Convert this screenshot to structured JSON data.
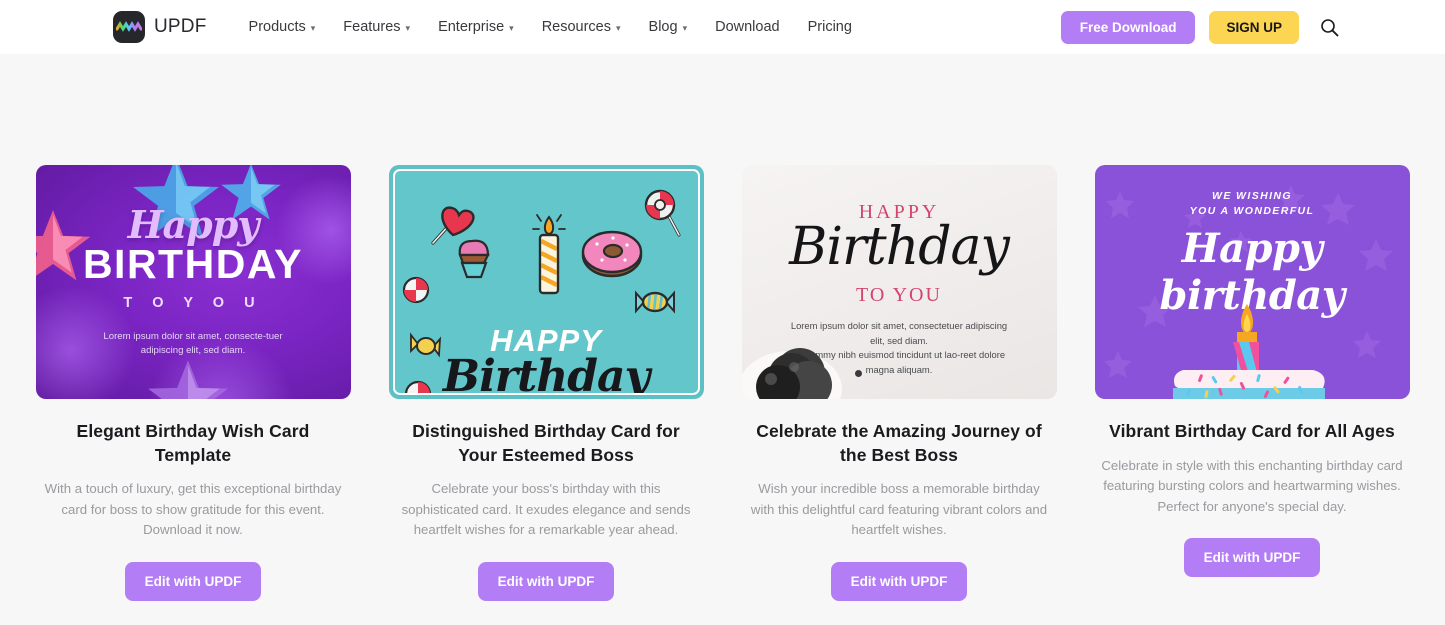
{
  "header": {
    "brand_name": "UPDF",
    "logo_icon": "updf-wave-logo-icon",
    "nav": [
      {
        "label": "Products",
        "has_dropdown": true
      },
      {
        "label": "Features",
        "has_dropdown": true
      },
      {
        "label": "Enterprise",
        "has_dropdown": true
      },
      {
        "label": "Resources",
        "has_dropdown": true
      },
      {
        "label": "Blog",
        "has_dropdown": true
      },
      {
        "label": "Download",
        "has_dropdown": false
      },
      {
        "label": "Pricing",
        "has_dropdown": false
      }
    ],
    "free_download_label": "Free Download",
    "sign_up_label": "SIGN UP",
    "search_icon": "search-icon",
    "colors": {
      "free_download_bg": "#b37ef5",
      "sign_up_bg": "#fcd552",
      "nav_text": "#3a3a3e",
      "header_bg": "#ffffff"
    }
  },
  "page": {
    "background": "#f7f7f7",
    "accent": "#b37ef5"
  },
  "cards": [
    {
      "title": "Elegant Birthday Wish Card Template",
      "description": "With a touch of luxury, get this exceptional birthday card for boss to show gratitude for this event. Download it now.",
      "button_label": "Edit with UPDF",
      "preview": {
        "style": "purple-balloons",
        "line_script": "Happy",
        "line_bold": "BIRTHDAY",
        "line_small": "T O  Y O U",
        "lorem": "Lorem ipsum dolor sit amet, consecte-tuer adipiscing elit, sed diam.",
        "bg_color": "#7b25c4"
      }
    },
    {
      "title": "Distinguished Birthday Card for Your Esteemed Boss",
      "description": "Celebrate your boss's birthday with this sophisticated card. It exudes elegance and sends heartfelt wishes for a remarkable year ahead.",
      "button_label": "Edit with UPDF",
      "preview": {
        "style": "teal-candy",
        "line_bold": "HAPPY",
        "line_script": "Birthday",
        "bg_color": "#63c6ca"
      }
    },
    {
      "title": "Celebrate the Amazing Journey of the Best Boss",
      "description": "Wish your incredible boss a memorable birthday with this delightful card featuring vibrant colors and heartfelt wishes.",
      "button_label": "Edit with UPDF",
      "preview": {
        "style": "cream-elegant",
        "line_top": "HAPPY",
        "line_script": "Birthday",
        "line_small": "TO YOU",
        "lorem_1": "Lorem ipsum dolor sit amet, consectetuer adipiscing elit, sed diam.",
        "lorem_2": "Nonummy nibh euismod tincidunt ut lao-reet dolore magna aliquam.",
        "bg_color": "#f1eeec"
      }
    },
    {
      "title": "Vibrant Birthday Card for All Ages",
      "description": "Celebrate in style with this enchanting birthday card featuring bursting colors and heartwarming wishes. Perfect for anyone's special day.",
      "button_label": "Edit with UPDF",
      "preview": {
        "style": "purple-cake",
        "line_top_1": "WE WISHING",
        "line_top_2": "YOU A WONDERFUL",
        "line_script": "Happy birthday",
        "bg_color": "#8a52d8"
      }
    }
  ]
}
